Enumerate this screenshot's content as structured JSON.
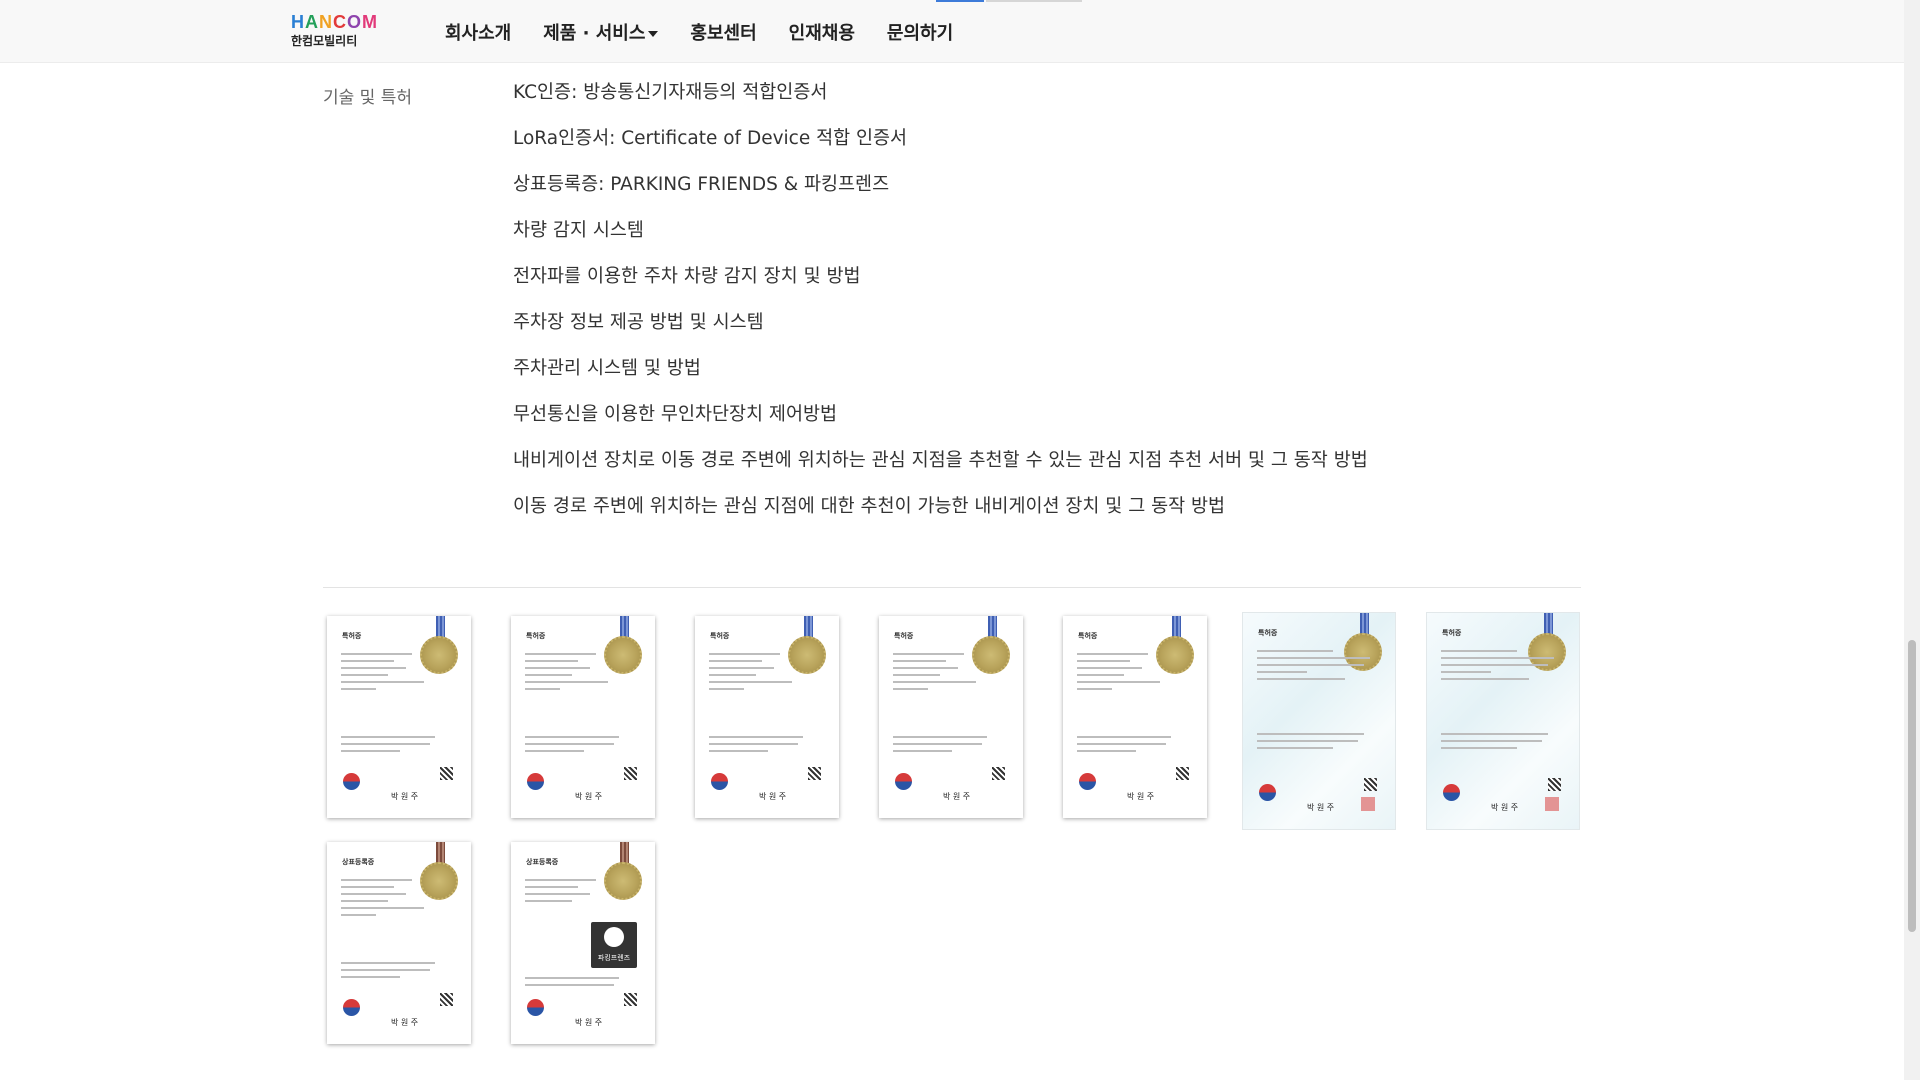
{
  "header": {
    "logo_text": "HANCOM",
    "logo_letters": [
      {
        "char": "H",
        "color": "#2a7fd4"
      },
      {
        "char": "A",
        "color": "#24a05a"
      },
      {
        "char": "N",
        "color": "#f0a223"
      },
      {
        "char": "C",
        "color": "#e23a3a"
      },
      {
        "char": "O",
        "color": "#8e44ad"
      },
      {
        "char": "M",
        "color": "#e23a7a"
      }
    ],
    "logo_sub": "한컴모빌리티",
    "nav": [
      "회사소개",
      "제품 · 서비스",
      "홍보센터",
      "인재채용",
      "문의하기"
    ]
  },
  "section": {
    "label": "기술 및 특허",
    "items": [
      "KC인증: 방송통신기자재등의 적합인증서",
      "LoRa인증서: Certificate of Device 적합 인증서",
      "상표등록증: PARKING FRIENDS & 파킹프렌즈",
      "차량 감지 시스템",
      "전자파를 이용한 주차 차량 감지 장치 및 방법",
      "주차장 정보 제공 방법 및 시스템",
      "주차관리 시스템 및 방법",
      "무선통신을 이용한 무인차단장치 제어방법",
      "내비게이션 장치로 이동 경로 주변에 위치하는 관심 지점을 추천할 수 있는 관심 지점 추천 서버 및 그 동작 방법",
      "이동 경로 주변에 위치하는 관심 지점에 대한 추천이 가능한 내비게이션 장치 및 그 동작 방법"
    ]
  },
  "certificates": {
    "patent_title": "특허증",
    "trademark_title": "상표등록증",
    "signature": "박 원 주",
    "trademark_logo_text": "파킹프렌즈"
  },
  "colors": {
    "ribbon_blue": "#3f5fb3",
    "ribbon_brown": "#7d4b3c",
    "seal_gold": "#b8a35b"
  }
}
